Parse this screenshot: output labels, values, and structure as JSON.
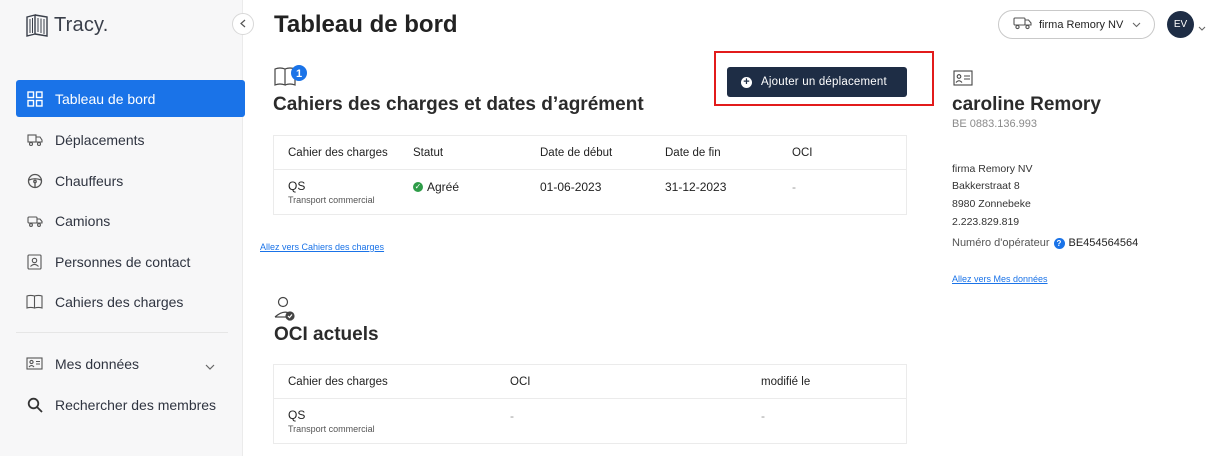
{
  "brand": {
    "name": "Tracy."
  },
  "sidebar": {
    "items": [
      {
        "label": "Tableau de bord",
        "icon": "dashboard-icon",
        "active": true
      },
      {
        "label": "Déplacements",
        "icon": "trips-icon"
      },
      {
        "label": "Chauffeurs",
        "icon": "steering-wheel-icon"
      },
      {
        "label": "Camions",
        "icon": "truck-icon"
      },
      {
        "label": "Personnes de contact",
        "icon": "contact-card-icon"
      },
      {
        "label": "Cahiers des charges",
        "icon": "book-icon"
      },
      {
        "label": "Mes données",
        "icon": "id-card-icon"
      },
      {
        "label": "Rechercher des membres",
        "icon": "search-icon"
      }
    ]
  },
  "header": {
    "title": "Tableau de bord",
    "company": "firma Remory NV",
    "avatar_initials": "EV"
  },
  "cahiers": {
    "badge": "1",
    "title": "Cahiers des charges et dates d’agrément",
    "add_button": "Ajouter un déplacement",
    "columns": [
      "Cahier des charges",
      "Statut",
      "Date de début",
      "Date de fin",
      "OCI"
    ],
    "rows": [
      {
        "name": "QS",
        "sub": "Transport commercial",
        "status": "Agréé",
        "start": "01-06-2023",
        "end": "31-12-2023",
        "oci": "-"
      }
    ],
    "link": "Allez vers Cahiers des charges"
  },
  "oci": {
    "title": "OCI actuels",
    "columns": [
      "Cahier des charges",
      "OCI",
      "modifié le"
    ],
    "rows": [
      {
        "name": "QS",
        "sub": "Transport commercial",
        "oci": "-",
        "modified": "-"
      }
    ]
  },
  "profile": {
    "name": "caroline Remory",
    "vat": "BE 0883.136.993",
    "company": "firma Remory NV",
    "street": "Bakkerstraat 8",
    "city": "8980 Zonnebeke",
    "phone": "2.223.829.819",
    "operator_label": "Numéro d'opérateur",
    "operator_number": "BE454564564",
    "link": "Allez vers Mes données"
  },
  "colors": {
    "accent": "#1a73e8",
    "navy": "#1e2d45",
    "highlight": "#e21b1b",
    "success": "#2e9c48"
  }
}
